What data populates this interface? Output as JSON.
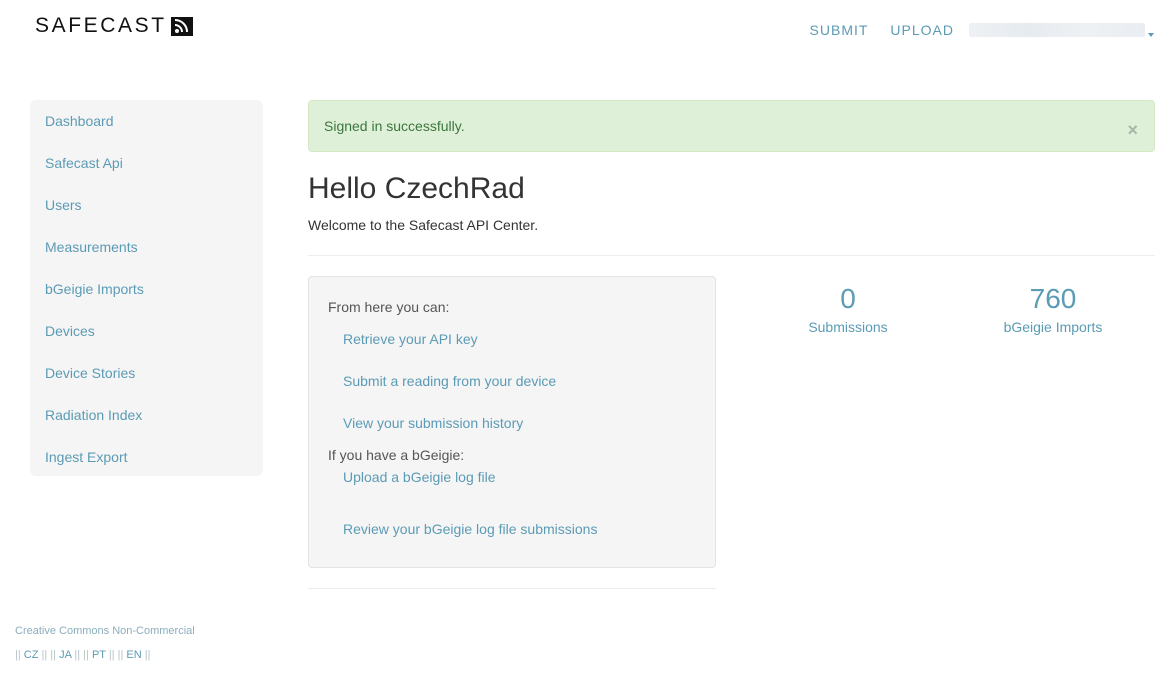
{
  "brand": {
    "name": "SAFECAST"
  },
  "topnav": {
    "submit_label": "SUBMIT",
    "upload_label": "UPLOAD"
  },
  "sidebar": {
    "items": [
      {
        "label": "Dashboard"
      },
      {
        "label": "Safecast Api"
      },
      {
        "label": "Users"
      },
      {
        "label": "Measurements"
      },
      {
        "label": "bGeigie Imports"
      },
      {
        "label": "Devices"
      },
      {
        "label": "Device Stories"
      },
      {
        "label": "Radiation Index"
      },
      {
        "label": "Ingest Export"
      }
    ]
  },
  "alert": {
    "message": "Signed in successfully.",
    "close_glyph": "×"
  },
  "main": {
    "greeting": "Hello CzechRad",
    "welcome": "Welcome to the Safecast API Center.",
    "well": {
      "intro": "From here you can:",
      "links": [
        {
          "label": "Retrieve your API key"
        },
        {
          "label": "Submit a reading from your device"
        },
        {
          "label": "View your submission history"
        }
      ],
      "intro2": "If you have a bGeigie:",
      "bgeigie_links": [
        {
          "label": "Upload a bGeigie log file"
        },
        {
          "label": "Review your bGeigie log file submissions"
        }
      ]
    },
    "stats": [
      {
        "value": "0",
        "label": "Submissions"
      },
      {
        "value": "760",
        "label": "bGeigie Imports"
      }
    ]
  },
  "footer": {
    "license": "Creative Commons Non-Commercial",
    "separator": "||",
    "languages": [
      "CZ",
      "JA",
      "PT",
      "EN"
    ]
  },
  "colors": {
    "link": "#5b9bb5",
    "alert_bg": "#dff0d8",
    "alert_text": "#3c763d",
    "sidebar_bg": "#f5f5f5"
  }
}
